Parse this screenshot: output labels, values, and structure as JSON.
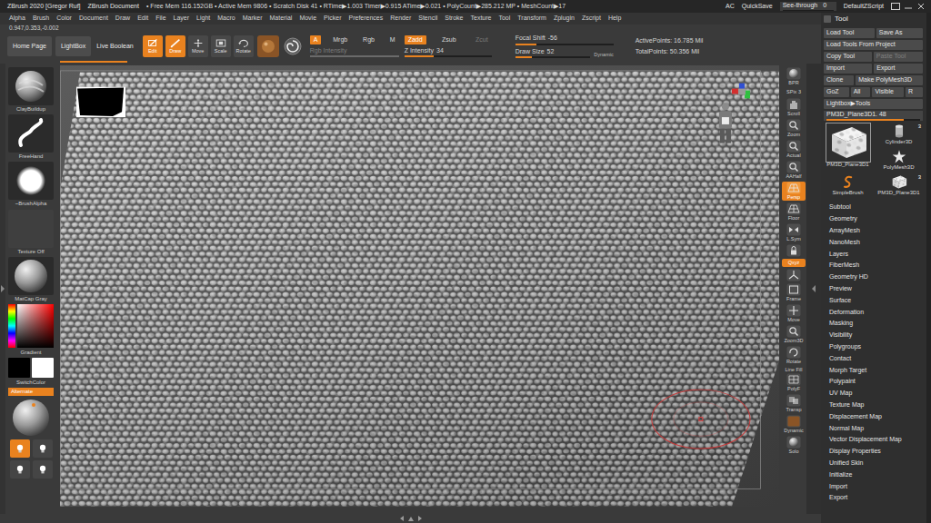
{
  "title_bar": {
    "app": "ZBrush 2020 [Gregor Ruf]",
    "document": "ZBrush Document",
    "stats": "• Free Mem 116.152GB • Active Mem 9806 • Scratch Disk 41 • RTime▶1.003 Timer▶0.915 ATime▶0.021 • PolyCount▶285.212 MP • MeshCount▶17",
    "ac": "AC",
    "quicksave": "QuickSave",
    "see_through": {
      "label": "See-through",
      "value": "0",
      "level": 0
    },
    "script": "DefaultZScript"
  },
  "menu": [
    "Alpha",
    "Brush",
    "Color",
    "Document",
    "Draw",
    "Edit",
    "File",
    "Layer",
    "Light",
    "Macro",
    "Marker",
    "Material",
    "Movie",
    "Picker",
    "Preferences",
    "Render",
    "Stencil",
    "Stroke",
    "Texture",
    "Tool",
    "Transform",
    "Zplugin",
    "Zscript",
    "Help"
  ],
  "coords": "0.947,0.353,-0.002",
  "activity": {
    "level": 0.088
  },
  "toolbar": {
    "nav": [
      {
        "label": "Home Page",
        "kind": "button"
      },
      {
        "label": "LightBox",
        "kind": "button"
      },
      {
        "label": "Live Boolean",
        "kind": "text"
      }
    ],
    "modes": [
      {
        "label": "Edit",
        "kind": "edit",
        "selected": true
      },
      {
        "label": "Draw",
        "kind": "draw",
        "selected": true
      },
      {
        "label": "Move",
        "kind": "move",
        "selected": false
      },
      {
        "label": "Scale",
        "kind": "scale",
        "selected": false
      },
      {
        "label": "Rotate",
        "kind": "rotate",
        "selected": false
      }
    ],
    "channels": [
      {
        "label": "A",
        "selected": true
      },
      {
        "label": "Mrgb",
        "selected": false
      },
      {
        "label": "Rgb",
        "selected": false
      },
      {
        "label": "M",
        "selected": false
      }
    ],
    "zmodes": [
      {
        "label": "Zadd",
        "selected": true,
        "disabled": false
      },
      {
        "label": "Zsub",
        "selected": false,
        "disabled": false
      },
      {
        "label": "Zcut",
        "selected": false,
        "disabled": true
      }
    ],
    "rgb_intensity": {
      "label": "Rgb Intensity",
      "level": 1,
      "disabled": true
    },
    "z_intensity": {
      "label": "Z Intensity",
      "value": "34",
      "level": 0.34,
      "disabled": false
    },
    "focal_shift": {
      "label": "Focal Shift",
      "value": "-56",
      "level": 0.22,
      "disabled": false
    },
    "draw_size": {
      "label": "Draw Size",
      "value": "52",
      "level": 0.22,
      "disabled": false
    },
    "dynamic": "Dynamic",
    "points": [
      "ActivePoints: 16.785 Mil",
      "TotalPoints: 50.356 Mil"
    ]
  },
  "left_shelf": {
    "items": [
      {
        "label": "ClayBuildup",
        "kind": "brush"
      },
      {
        "label": "FreeHand",
        "kind": "stroke"
      },
      {
        "label": "~BrushAlpha",
        "kind": "alpha"
      },
      {
        "label": "Texture Off",
        "kind": "texture"
      },
      {
        "label": "MatCap Gray",
        "kind": "material"
      }
    ],
    "gradient": "Gradient",
    "colors": [
      {
        "color": "#000000"
      },
      {
        "color": "#ffffff"
      }
    ],
    "switch": "SwitchColor",
    "alternate": {
      "label": "Alternate",
      "selected": true
    },
    "lights": [
      {
        "selected": true
      },
      {
        "selected": false
      },
      {
        "selected": false
      },
      {
        "selected": false
      }
    ]
  },
  "right_shelf": [
    {
      "label": "BPR",
      "kind": "sphere",
      "on": false
    },
    {
      "label": "SPix 3",
      "kind": "text",
      "on": false
    },
    {
      "label": "Scroll",
      "kind": "hand",
      "on": false
    },
    {
      "label": "Zoom",
      "kind": "mag",
      "on": false
    },
    {
      "label": "Actual",
      "kind": "mag",
      "on": false
    },
    {
      "label": "AAHalf",
      "kind": "mag",
      "on": false
    },
    {
      "label": "Persp",
      "kind": "grid",
      "on": true
    },
    {
      "label": "Floor",
      "kind": "grid",
      "on": false
    },
    {
      "label": "L.Sym",
      "kind": "sym",
      "on": false
    },
    {
      "kind": "lock",
      "on": false
    },
    {
      "label": "Qxyz",
      "kind": "text",
      "on": true
    },
    {
      "kind": "axis",
      "on": false
    },
    {
      "label": "Frame",
      "kind": "frame",
      "on": false
    },
    {
      "label": "Move",
      "kind": "move",
      "on": false
    },
    {
      "label": "Zoom3D",
      "kind": "mag",
      "on": false
    },
    {
      "label": "Rotate",
      "kind": "rotate",
      "on": false
    },
    {
      "label": "PolyF",
      "caption": "Line Fill",
      "kind": "poly",
      "on": false
    },
    {
      "label": "Transp",
      "kind": "transp",
      "on": false
    },
    {
      "label": "Dynamic",
      "kind": "swatch",
      "on": false
    },
    {
      "label": "Solo",
      "kind": "sphere",
      "on": false
    }
  ],
  "tool_panel": {
    "title": "Tool",
    "button_rows": [
      [
        {
          "label": "Load Tool",
          "disabled": false
        },
        {
          "label": "Save As",
          "disabled": false
        }
      ],
      [
        {
          "label": "Load Tools From Project",
          "disabled": false
        }
      ],
      [
        {
          "label": "Copy Tool",
          "disabled": false
        },
        {
          "label": "Paste Tool",
          "disabled": true
        }
      ],
      [
        {
          "label": "Import",
          "disabled": false
        },
        {
          "label": "Export",
          "disabled": false
        }
      ],
      [
        {
          "label": "Clone",
          "disabled": false
        },
        {
          "label": "Make PolyMesh3D",
          "disabled": false
        }
      ],
      [
        {
          "label": "GoZ",
          "disabled": false
        },
        {
          "label": "All",
          "disabled": false
        },
        {
          "label": "Visible",
          "disabled": false
        },
        {
          "label": "R",
          "disabled": false
        }
      ],
      [
        {
          "label": "Lightbox▶Tools",
          "disabled": false
        }
      ]
    ],
    "current": {
      "label": "PM3D_Plane3D1. 48",
      "level": 0.83
    },
    "tools": [
      {
        "label": "PM3D_Plane3D1",
        "kind": "plane",
        "selected": true
      },
      {
        "label": "Cylinder3D",
        "kind": "cylinder",
        "selected": false,
        "badge": "3"
      },
      {
        "label": "PolyMesh3D",
        "kind": "star",
        "selected": false
      },
      {
        "label": "SimpleBrush",
        "kind": "brush",
        "selected": false
      },
      {
        "label": "PM3D_Plane3D1",
        "kind": "plane",
        "selected": false,
        "badge": "3"
      }
    ],
    "sections": [
      "Subtool",
      "Geometry",
      "ArrayMesh",
      "NanoMesh",
      "Layers",
      "FiberMesh",
      "Geometry HD",
      "Preview",
      "Surface",
      "Deformation",
      "Masking",
      "Visibility",
      "Polygroups",
      "Contact",
      "Morph Target",
      "Polypaint",
      "UV Map",
      "Texture Map",
      "Displacement Map",
      "Normal Map",
      "Vector Displacement Map",
      "Display Properties",
      "Unified Skin",
      "Initialize",
      "Import",
      "Export"
    ]
  }
}
